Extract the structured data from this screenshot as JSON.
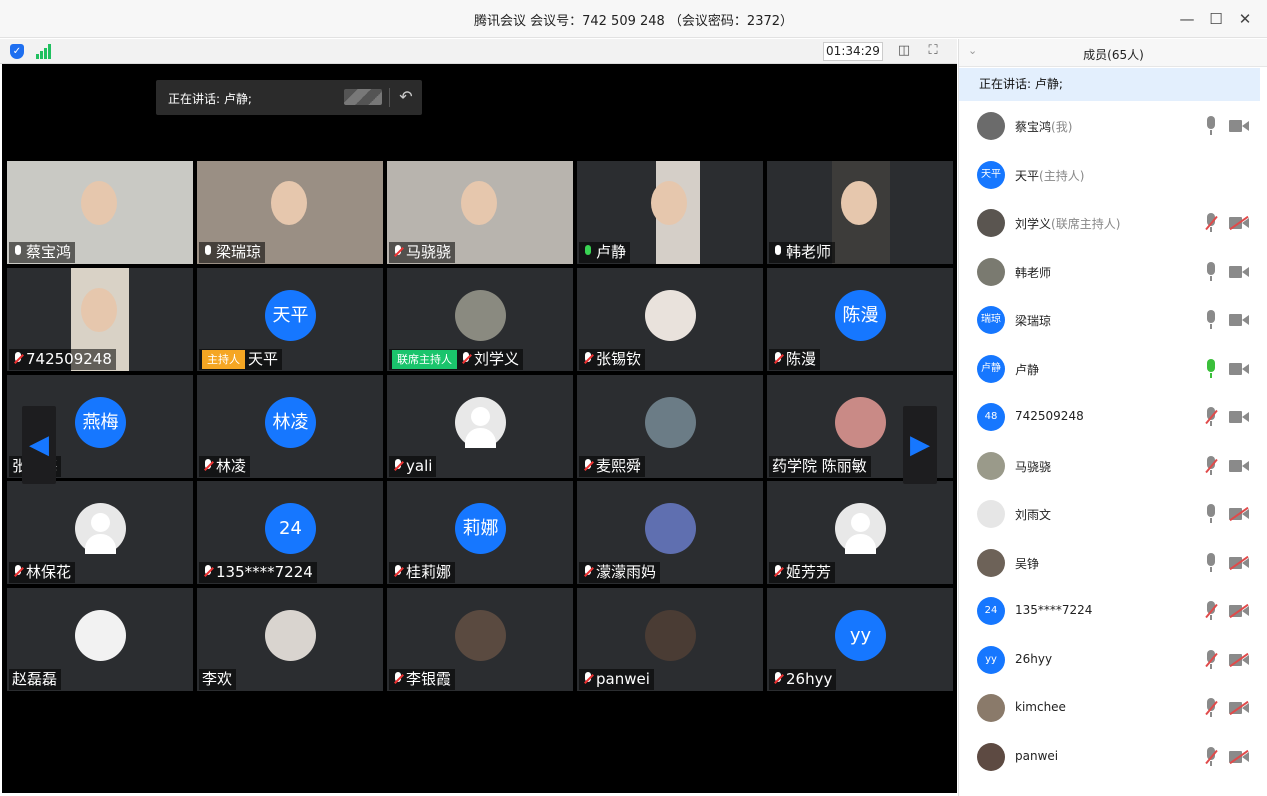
{
  "window": {
    "title": "腾讯会议 会议号：742 509 248 （会议密码：2372）",
    "controls": [
      "minimize-icon",
      "maximize-icon",
      "close-icon"
    ]
  },
  "toolbar": {
    "timer": "01:34:29",
    "icons": [
      "shield-icon",
      "signal-icon",
      "layout-icon",
      "fullscreen-icon"
    ]
  },
  "speaking_bar": {
    "text": "正在讲话: 卢静;"
  },
  "grid": {
    "tiles": [
      {
        "name": "蔡宝鸿",
        "mic": "on",
        "type": "video",
        "bg": "#c9c9c4"
      },
      {
        "name": "梁瑞琼",
        "mic": "on",
        "type": "video",
        "bg": "#9a8f84"
      },
      {
        "name": "马骁骁",
        "mic": "muted",
        "type": "video",
        "bg": "#b8b4ae"
      },
      {
        "name": "卢静",
        "mic": "speaking",
        "type": "video",
        "bg": "#d5cfc8"
      },
      {
        "name": "韩老师",
        "mic": "on",
        "type": "video",
        "bg": "#3d3c3a"
      },
      {
        "name": "742509248",
        "mic": "muted",
        "type": "video",
        "bg": "#d9d2c6"
      },
      {
        "name": "天平",
        "mic": "none",
        "type": "avatar",
        "avatar": "天平",
        "badge": "主持人",
        "badge_kind": "host"
      },
      {
        "name": "刘学义",
        "mic": "muted",
        "type": "photo",
        "badge": "联席主持人",
        "badge_kind": "cohost",
        "photo": "#8a8a80"
      },
      {
        "name": "张锡钦",
        "mic": "muted",
        "type": "photo",
        "photo": "#e9e2dc"
      },
      {
        "name": "陈漫",
        "mic": "muted",
        "type": "avatar",
        "avatar": "陈漫"
      },
      {
        "name": "张燕梅",
        "mic": "none",
        "type": "avatar",
        "avatar": "燕梅"
      },
      {
        "name": "林凌",
        "mic": "muted",
        "type": "avatar",
        "avatar": "林凌"
      },
      {
        "name": "yali",
        "mic": "muted",
        "type": "grey"
      },
      {
        "name": "麦熙舜",
        "mic": "muted",
        "type": "photo",
        "photo": "#6b7c86"
      },
      {
        "name": "药学院 陈丽敏",
        "mic": "none",
        "type": "photo",
        "photo": "#c98a86"
      },
      {
        "name": "林保花",
        "mic": "muted",
        "type": "grey"
      },
      {
        "name": "135****7224",
        "mic": "muted",
        "type": "avatar",
        "avatar": "24"
      },
      {
        "name": "桂莉娜",
        "mic": "muted",
        "type": "avatar",
        "avatar": "莉娜"
      },
      {
        "name": "濛濛雨妈",
        "mic": "muted",
        "type": "photo",
        "photo": "#5f6fb0"
      },
      {
        "name": "姬芳芳",
        "mic": "muted",
        "type": "grey"
      },
      {
        "name": "赵磊磊",
        "mic": "none",
        "type": "photo",
        "photo": "#f2f2f2"
      },
      {
        "name": "李欢",
        "mic": "none",
        "type": "photo",
        "photo": "#d9d4cf"
      },
      {
        "name": "李银霞",
        "mic": "muted",
        "type": "photo",
        "photo": "#5a4a40"
      },
      {
        "name": "panwei",
        "mic": "muted",
        "type": "photo",
        "photo": "#4a3c34"
      },
      {
        "name": "26hyy",
        "mic": "muted",
        "type": "avatar",
        "avatar": "yy"
      }
    ]
  },
  "nav": {
    "prev_icon": "chevron-left-icon",
    "next_icon": "chevron-right-icon"
  },
  "panel": {
    "title": "成员(65人)",
    "speaking": "正在讲话: 卢静;",
    "members": [
      {
        "name": "蔡宝鸿",
        "role": "(我)",
        "avatar_kind": "photo",
        "mic": "on",
        "cam": "on",
        "avatar_text": ""
      },
      {
        "name": "天平",
        "role": "(主持人)",
        "avatar_kind": "text",
        "mic": "none",
        "cam": "none",
        "avatar_text": "天平"
      },
      {
        "name": "刘学义",
        "role": "(联席主持人)",
        "avatar_kind": "photo",
        "mic": "muted",
        "cam": "off",
        "avatar_text": ""
      },
      {
        "name": "韩老师",
        "role": "",
        "avatar_kind": "photo",
        "mic": "on",
        "cam": "on",
        "avatar_text": ""
      },
      {
        "name": "梁瑞琼",
        "role": "",
        "avatar_kind": "text",
        "mic": "on",
        "cam": "on",
        "avatar_text": "瑞琼"
      },
      {
        "name": "卢静",
        "role": "",
        "avatar_kind": "text",
        "mic": "speaking",
        "cam": "on",
        "avatar_text": "卢静"
      },
      {
        "name": "742509248",
        "role": "",
        "avatar_kind": "text",
        "mic": "muted",
        "cam": "on",
        "avatar_text": "48"
      },
      {
        "name": "马骁骁",
        "role": "",
        "avatar_kind": "photo",
        "mic": "muted",
        "cam": "on",
        "avatar_text": ""
      },
      {
        "name": "刘雨文",
        "role": "",
        "avatar_kind": "grey",
        "mic": "on",
        "cam": "off",
        "avatar_text": ""
      },
      {
        "name": "吴铮",
        "role": "",
        "avatar_kind": "photo",
        "mic": "on",
        "cam": "off",
        "avatar_text": ""
      },
      {
        "name": "135****7224",
        "role": "",
        "avatar_kind": "text",
        "mic": "muted",
        "cam": "off",
        "avatar_text": "24"
      },
      {
        "name": "26hyy",
        "role": "",
        "avatar_kind": "text",
        "mic": "muted",
        "cam": "off",
        "avatar_text": "yy"
      },
      {
        "name": "kimchee",
        "role": "",
        "avatar_kind": "photo",
        "mic": "muted",
        "cam": "off",
        "avatar_text": ""
      },
      {
        "name": "panwei",
        "role": "",
        "avatar_kind": "photo",
        "mic": "muted",
        "cam": "off",
        "avatar_text": ""
      }
    ]
  },
  "colors": {
    "accent": "#1677ff",
    "host_badge": "#f5a623",
    "cohost_badge": "#1ac46c",
    "speaking_green": "#39d353",
    "muted_red": "#e04a4a"
  }
}
